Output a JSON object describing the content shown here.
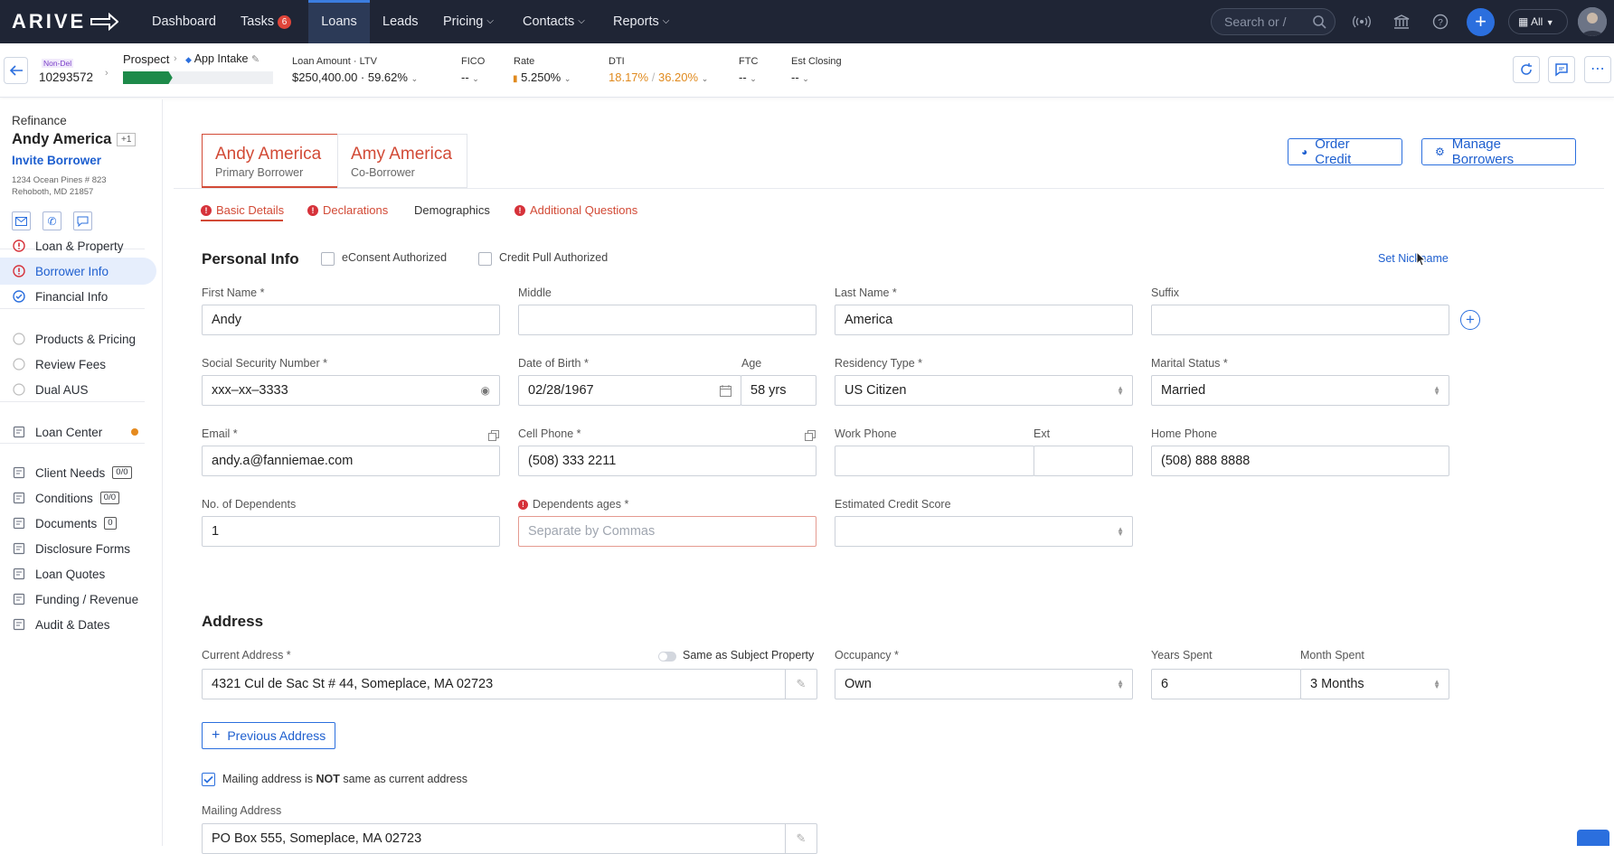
{
  "nav": {
    "logo": "ARIVE",
    "items": [
      "Dashboard",
      "Tasks",
      "Loans",
      "Leads",
      "Pricing",
      "Contacts",
      "Reports"
    ],
    "tasks_badge": "6",
    "search_placeholder": "Search or /",
    "all_label": "All"
  },
  "loanbar": {
    "non_del": "Non-Del",
    "loan_number": "10293572",
    "stage": "Prospect",
    "substage": "App Intake",
    "progress_fraction": 0.33,
    "loan_amount_label": "Loan Amount",
    "ltv_label": "LTV",
    "loan_amount": "$250,400.00",
    "ltv": "59.62%",
    "fico_label": "FICO",
    "fico": "--",
    "rate_label": "Rate",
    "rate": "5.250%",
    "dti_label": "DTI",
    "dti_front": "18.17%",
    "dti_back": "36.20%",
    "ftc_label": "FTC",
    "ftc": "--",
    "est_closing_label": "Est Closing",
    "est_closing": "--"
  },
  "sidebar": {
    "loan_type": "Refinance",
    "borrower_name": "Andy America",
    "plus_count": "+1",
    "invite": "Invite Borrower",
    "address_line1": "1234 Ocean Pines # 823",
    "address_line2": "Rehoboth, MD 21857",
    "items": [
      {
        "label": "Loan & Property",
        "icon": "alert-icon"
      },
      {
        "label": "Borrower Info",
        "icon": "alert-icon"
      },
      {
        "label": "Financial Info",
        "icon": "check-icon"
      },
      {
        "label": "Products & Pricing",
        "icon": "circle-icon"
      },
      {
        "label": "Review Fees",
        "icon": "circle-icon"
      },
      {
        "label": "Dual AUS",
        "icon": "circle-icon"
      },
      {
        "label": "Loan Center",
        "icon": "loan-center-icon"
      },
      {
        "label": "Client Needs",
        "icon": "client-needs-icon",
        "count": "0/0"
      },
      {
        "label": "Conditions",
        "icon": "conditions-icon",
        "count": "0/0"
      },
      {
        "label": "Documents",
        "icon": "documents-icon",
        "count": "0"
      },
      {
        "label": "Disclosure Forms",
        "icon": "disclosure-icon"
      },
      {
        "label": "Loan Quotes",
        "icon": "quotes-icon"
      },
      {
        "label": "Funding / Revenue",
        "icon": "funding-icon"
      },
      {
        "label": "Audit & Dates",
        "icon": "audit-icon"
      }
    ]
  },
  "borrowers": [
    {
      "name": "Andy America",
      "role": "Primary Borrower"
    },
    {
      "name": "Amy America",
      "role": "Co-Borrower"
    }
  ],
  "actions": {
    "order_credit": "Order Credit",
    "manage_borrowers": "Manage Borrowers"
  },
  "subtabs": [
    "Basic Details",
    "Declarations",
    "Demographics",
    "Additional Questions"
  ],
  "personal": {
    "title": "Personal Info",
    "econsent": "eConsent Authorized",
    "credit_pull": "Credit Pull Authorized",
    "set_nickname": "Set Nickname",
    "first_name_label": "First Name *",
    "first_name": "Andy",
    "middle_label": "Middle",
    "last_name_label": "Last Name *",
    "last_name": "America",
    "suffix_label": "Suffix",
    "ssn_label": "Social Security Number *",
    "ssn": "xxx–xx–3333",
    "dob_label": "Date of Birth *",
    "dob": "02/28/1967",
    "age_label": "Age",
    "age": "58 yrs",
    "residency_label": "Residency Type *",
    "residency": "US Citizen",
    "marital_label": "Marital Status *",
    "marital": "Married",
    "email_label": "Email *",
    "email": "andy.a@fanniemae.com",
    "cell_label": "Cell Phone *",
    "cell": "(508) 333 2211",
    "work_label": "Work Phone",
    "ext_label": "Ext",
    "home_label": "Home Phone",
    "home": "(508) 888 8888",
    "dependents_label": "No. of Dependents",
    "dependents": "1",
    "dep_ages_label": "Dependents ages *",
    "dep_ages_placeholder": "Separate by Commas",
    "credit_score_label": "Estimated Credit Score"
  },
  "address": {
    "title": "Address",
    "current_label": "Current Address *",
    "same_as_subject": "Same as Subject Property",
    "current": "4321 Cul de Sac St # 44, Someplace, MA 02723",
    "occupancy_label": "Occupancy *",
    "occupancy": "Own",
    "years_label": "Years Spent",
    "years": "6",
    "months_label": "Month Spent",
    "months": "3 Months",
    "prev_button": "Previous Address",
    "mailing_check_a": "Mailing address is",
    "mailing_check_b": "NOT",
    "mailing_check_c": "same as current address",
    "mailing_label": "Mailing Address",
    "mailing": "PO Box 555, Someplace, MA 02723"
  },
  "colors": {
    "nav_bg": "#1f2535",
    "accent": "#2b6fde",
    "error": "#d24a36",
    "progress": "#1e8a4a"
  }
}
